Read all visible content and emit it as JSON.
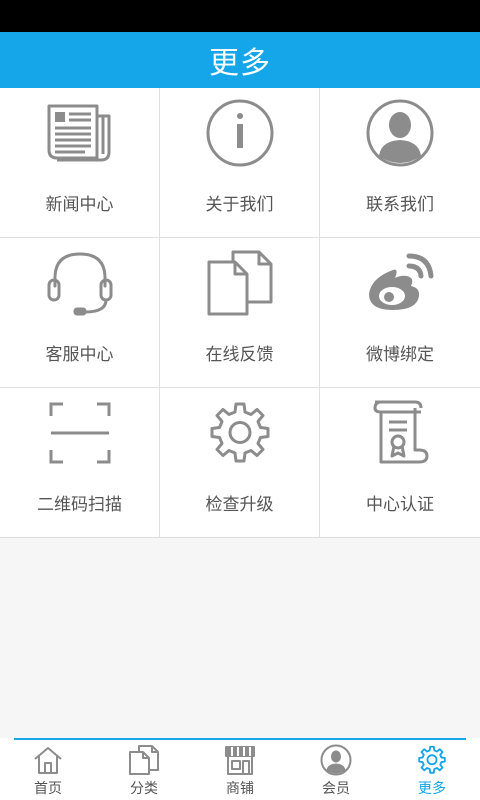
{
  "header": {
    "title": "更多"
  },
  "colors": {
    "accent": "#14a6e8",
    "icon": "#8c8c8c"
  },
  "grid": {
    "items": [
      {
        "label": "新闻中心",
        "icon": "newspaper-icon"
      },
      {
        "label": "关于我们",
        "icon": "info-icon"
      },
      {
        "label": "联系我们",
        "icon": "user-avatar-icon"
      },
      {
        "label": "客服中心",
        "icon": "headset-icon"
      },
      {
        "label": "在线反馈",
        "icon": "documents-icon"
      },
      {
        "label": "微博绑定",
        "icon": "weibo-icon"
      },
      {
        "label": "二维码扫描",
        "icon": "scan-icon"
      },
      {
        "label": "检查升级",
        "icon": "gear-icon"
      },
      {
        "label": "中心认证",
        "icon": "certificate-icon"
      }
    ]
  },
  "tabbar": {
    "items": [
      {
        "label": "首页",
        "icon": "home-icon",
        "active": false
      },
      {
        "label": "分类",
        "icon": "category-icon",
        "active": false
      },
      {
        "label": "商铺",
        "icon": "store-icon",
        "active": false
      },
      {
        "label": "会员",
        "icon": "member-icon",
        "active": false
      },
      {
        "label": "更多",
        "icon": "gear-icon",
        "active": true
      }
    ]
  }
}
